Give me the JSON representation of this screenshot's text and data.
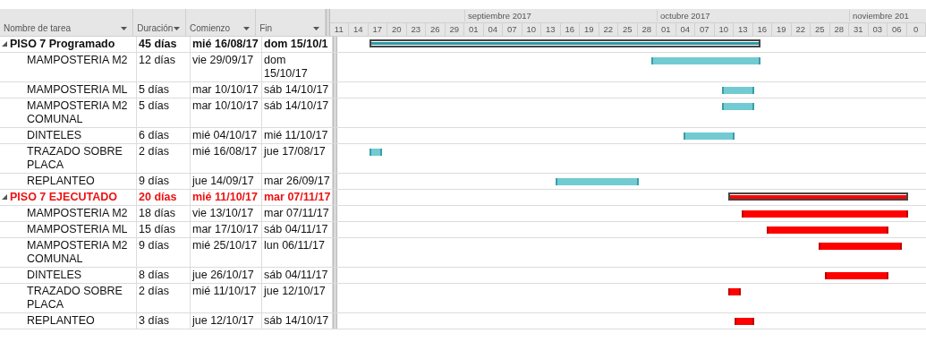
{
  "columns": [
    {
      "label": "Nombre de tarea"
    },
    {
      "label": "Duración"
    },
    {
      "label": "Comienzo"
    },
    {
      "label": "Fin"
    }
  ],
  "timescale": [
    {
      "day": "11"
    },
    {
      "day": "14"
    },
    {
      "day": "17"
    },
    {
      "day": "20"
    },
    {
      "day": "23"
    },
    {
      "day": "26"
    },
    {
      "day": "29"
    },
    {
      "day": "01",
      "month": "septiembre 2017"
    },
    {
      "day": "04"
    },
    {
      "day": "07"
    },
    {
      "day": "10"
    },
    {
      "day": "13"
    },
    {
      "day": "16"
    },
    {
      "day": "19"
    },
    {
      "day": "22"
    },
    {
      "day": "25"
    },
    {
      "day": "28"
    },
    {
      "day": "01",
      "month": "octubre 2017"
    },
    {
      "day": "04"
    },
    {
      "day": "07"
    },
    {
      "day": "10"
    },
    {
      "day": "13"
    },
    {
      "day": "16"
    },
    {
      "day": "19"
    },
    {
      "day": "22"
    },
    {
      "day": "25"
    },
    {
      "day": "28"
    },
    {
      "day": "31",
      "month": "noviembre 201"
    },
    {
      "day": "03"
    },
    {
      "day": "06"
    },
    {
      "day": "0"
    }
  ],
  "groups": [
    {
      "name": "PISO 7 Programado",
      "duration": "45 días",
      "start": "mié 16/08/17",
      "end": "dom 15/10/1",
      "expanded": true,
      "critical": false,
      "children": [
        {
          "name": "MAMPOSTERIA M2",
          "duration": "12 días",
          "start": "vie 29/09/17",
          "end": "dom 15/10/17"
        },
        {
          "name": "MAMPOSTERIA ML",
          "duration": "5 días",
          "start": "mar 10/10/17",
          "end": "sáb 14/10/17"
        },
        {
          "name": "MAMPOSTERIA M2 COMUNAL",
          "duration": "5 días",
          "start": "mar 10/10/17",
          "end": "sáb 14/10/17"
        },
        {
          "name": "DINTELES",
          "duration": "6 días",
          "start": "mié 04/10/17",
          "end": "mié 11/10/17"
        },
        {
          "name": "TRAZADO SOBRE PLACA",
          "duration": "2 días",
          "start": "mié 16/08/17",
          "end": "jue 17/08/17"
        },
        {
          "name": "REPLANTEO",
          "duration": "9 días",
          "start": "jue 14/09/17",
          "end": "mar 26/09/17"
        }
      ]
    },
    {
      "name": "PISO 7 EJECUTADO",
      "duration": "20 días",
      "start": "mié 11/10/17",
      "end": "mar 07/11/17",
      "expanded": true,
      "critical": true,
      "children": [
        {
          "name": "MAMPOSTERIA M2",
          "duration": "18 días",
          "start": "vie 13/10/17",
          "end": "mar 07/11/17"
        },
        {
          "name": "MAMPOSTERIA ML",
          "duration": "15 días",
          "start": "mar 17/10/17",
          "end": "sáb 04/11/17"
        },
        {
          "name": "MAMPOSTERIA M2 COMUNAL",
          "duration": "9 días",
          "start": "mié 25/10/17",
          "end": "lun 06/11/17"
        },
        {
          "name": "DINTELES",
          "duration": "8 días",
          "start": "jue 26/10/17",
          "end": "sáb 04/11/17"
        },
        {
          "name": "TRAZADO SOBRE PLACA",
          "duration": "2 días",
          "start": "mié 11/10/17",
          "end": "jue 12/10/17"
        },
        {
          "name": "REPLANTEO",
          "duration": "3 días",
          "start": "jue 12/10/17",
          "end": "sáb 14/10/17"
        }
      ]
    }
  ]
}
